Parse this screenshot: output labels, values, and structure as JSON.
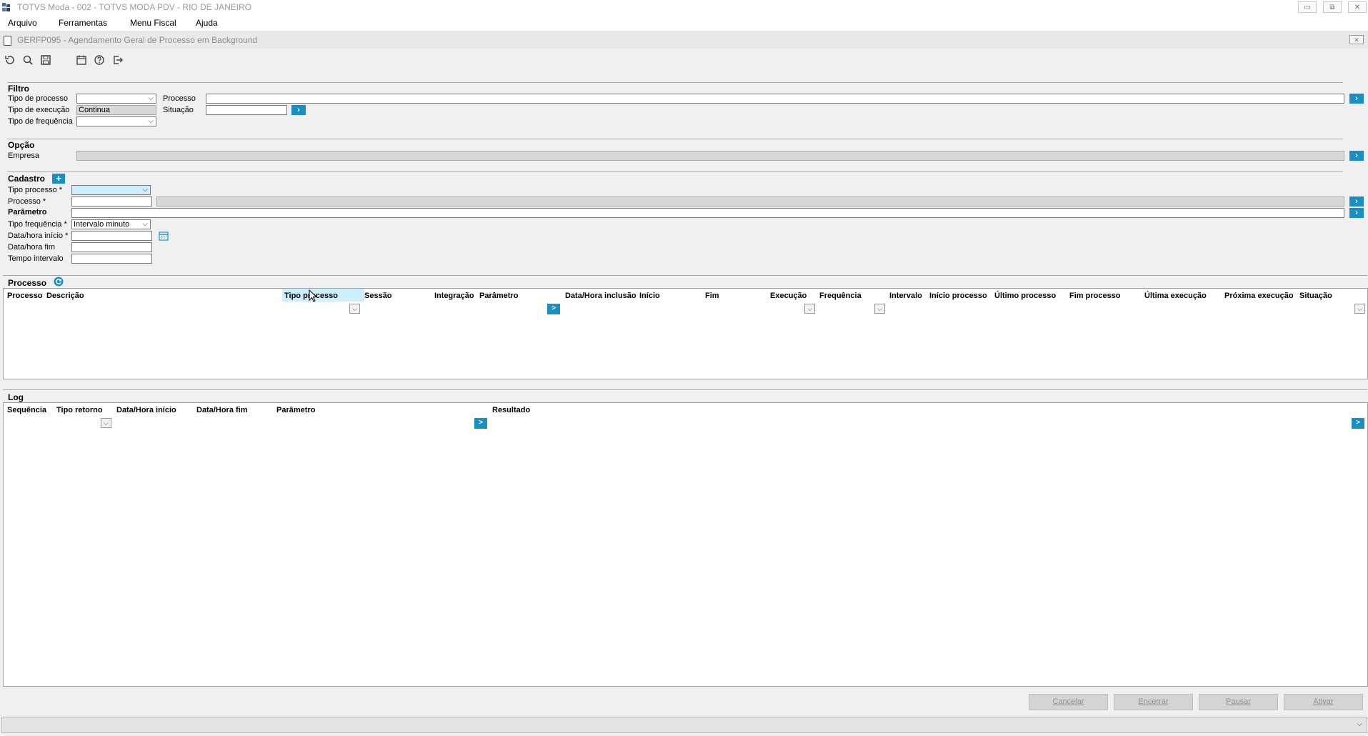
{
  "window": {
    "title": "TOTVS Moda - 002 - TOTVS MODA PDV - RIO DE JANEIRO",
    "minimize": "▭",
    "restore": "⧉",
    "close": "✕"
  },
  "menu": [
    "Arquivo",
    "Ferramentas",
    "Menu Fiscal",
    "Ajuda"
  ],
  "form": {
    "title": "GERFP095 - Agendamento Geral de Processo em Background",
    "close": "✕"
  },
  "toolbar": {
    "icons": [
      "refresh-icon",
      "search-icon",
      "save-icon",
      "calendar-icon",
      "help-icon",
      "exit-icon"
    ]
  },
  "filtro": {
    "title": "Filtro",
    "tipo_processo_label": "Tipo de processo",
    "tipo_execucao_label": "Tipo de execução",
    "tipo_execucao_value": "Continua",
    "tipo_frequencia_label": "Tipo de frequência",
    "processo_label": "Processo",
    "situacao_label": "Situação",
    "go": "›"
  },
  "opcao": {
    "title": "Opção",
    "empresa_label": "Empresa",
    "go": "›"
  },
  "cadastro": {
    "title": "Cadastro",
    "add": "+",
    "tipo_processo_label": "Tipo processo *",
    "processo_label": "Processo *",
    "parametro_label": "Parâmetro",
    "tipo_frequencia_label": "Tipo frequência *",
    "tipo_frequencia_value": "Intervalo minuto",
    "data_inicio_label": "Data/hora início *",
    "data_fim_label": "Data/hora fim",
    "tempo_intervalo_label": "Tempo intervalo",
    "go": "›"
  },
  "processo": {
    "title": "Processo",
    "columns": [
      "Processo",
      "Descrição",
      "Tipo processo",
      "Sessão",
      "Integração",
      "Parâmetro",
      "Data/Hora inclusão",
      "Início",
      "Fim",
      "Execução",
      "Frequência",
      "Intervalo",
      "Início processo",
      "Último processo",
      "Fim processo",
      "Última execução",
      "Próxima execução",
      "Situação"
    ],
    "go": ">"
  },
  "log": {
    "title": "Log",
    "columns": [
      "Sequência",
      "Tipo retorno",
      "Data/Hora início",
      "Data/Hora fim",
      "Parâmetro",
      "Resultado"
    ],
    "go": ">"
  },
  "buttons": {
    "cancelar": "Cancelar",
    "encerrar": "Encerrar",
    "pausar": "Pausar",
    "ativar": "Ativar"
  },
  "colors": {
    "accent": "#1a8fc1",
    "highlight": "#cdeffb"
  }
}
